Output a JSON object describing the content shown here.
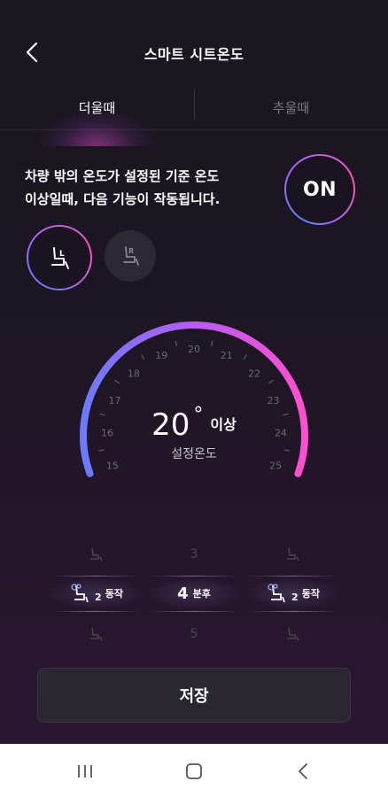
{
  "header": {
    "title": "스마트 시트온도"
  },
  "tabs": [
    {
      "label": "더울때",
      "active": true
    },
    {
      "label": "추울때",
      "active": false
    }
  ],
  "description": {
    "line1": "차량 밖의 온도가 설정된 기준 온도",
    "line2": "이상일때, 다음 기능이 작동됩니다."
  },
  "toggle": {
    "label": "ON"
  },
  "seats": [
    {
      "icon": "seat-left-icon",
      "selected": true
    },
    {
      "icon": "seat-right-icon",
      "selected": false
    }
  ],
  "gauge": {
    "ticks": [
      "15",
      "16",
      "17",
      "18",
      "19",
      "20",
      "21",
      "22",
      "23",
      "24",
      "25"
    ],
    "value": "20",
    "degree": "°",
    "suffix": "이상",
    "caption": "설정온도",
    "min": 15,
    "max": 25,
    "current": 20,
    "colors": {
      "start": "#6b7bff",
      "mid": "#b65cf0",
      "end": "#ff4fd0",
      "track": "#2a2430"
    }
  },
  "picker": {
    "left": {
      "above_icon": "seat-vent-icon",
      "selected_value": "2",
      "selected_suffix": "동작",
      "below_icon": "seat-vent-icon"
    },
    "center": {
      "above": "3",
      "selected_value": "4",
      "selected_suffix": "분후",
      "below": "5"
    },
    "right": {
      "above_icon": "seat-vent-icon",
      "selected_value": "2",
      "selected_suffix": "동작",
      "below_icon": "seat-vent-icon"
    }
  },
  "save": {
    "label": "저장"
  },
  "navbar": {
    "items": [
      "recent-apps",
      "home",
      "back"
    ]
  }
}
